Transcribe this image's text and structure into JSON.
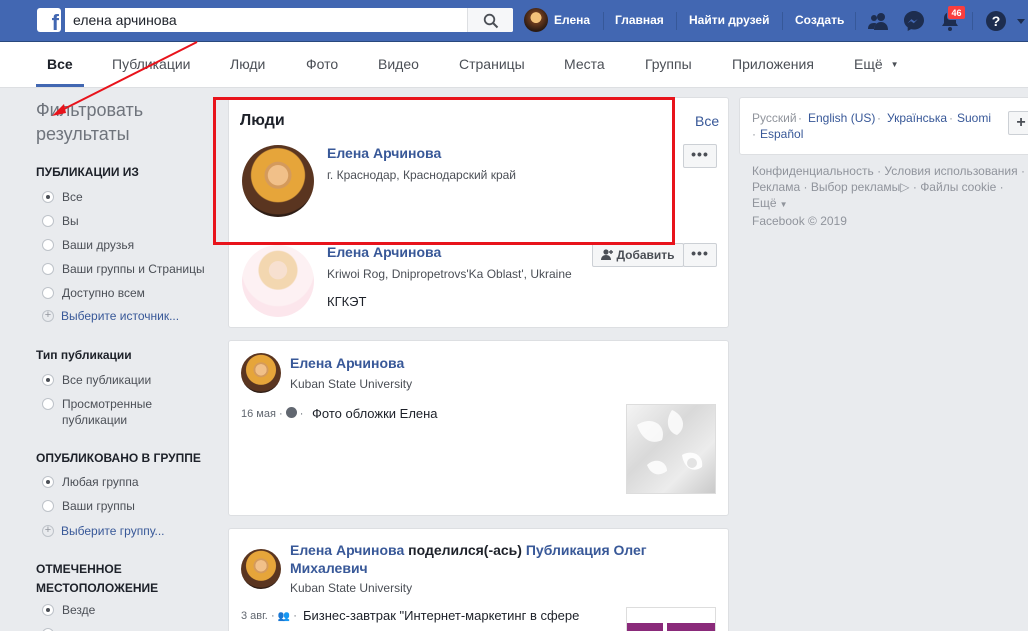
{
  "topbar": {
    "search_value": "елена арчинова",
    "user_name": "Елена",
    "nav_home": "Главная",
    "nav_find_friends": "Найти друзей",
    "nav_create": "Создать",
    "notifications_count": "46"
  },
  "tabs": [
    "Все",
    "Публикации",
    "Люди",
    "Фото",
    "Видео",
    "Страницы",
    "Места",
    "Группы",
    "Приложения",
    "Ещё"
  ],
  "filters": {
    "title": "Фильтровать результаты",
    "posts_from": {
      "heading": "ПУБЛИКАЦИИ ИЗ",
      "options": [
        "Все",
        "Вы",
        "Ваши друзья",
        "Ваши группы и Страницы",
        "Доступно всем"
      ],
      "selected": 0,
      "choose_link": "Выберите источник..."
    },
    "post_type": {
      "heading": "Тип публикации",
      "options": [
        "Все публикации",
        "Просмотренные публикации"
      ],
      "selected": 0
    },
    "posted_in_group": {
      "heading": "ОПУБЛИКОВАНО В ГРУППЕ",
      "options": [
        "Любая группа",
        "Ваши группы"
      ],
      "selected": 0,
      "choose_link": "Выберите группу..."
    },
    "tagged_location": {
      "heading": "ОТМЕЧЕННОЕ МЕСТОПОЛОЖЕНИЕ",
      "options": [
        "Везде"
      ],
      "selected": 0
    }
  },
  "people_card": {
    "heading": "Люди",
    "see_all": "Все",
    "people": [
      {
        "name": "Елена Арчинова",
        "location": "г. Краснодар, Краснодарский край"
      },
      {
        "name": "Елена Арчинова",
        "location": "Kriwoi Rog, Dnipropetrovs'Ka Oblast', Ukraine",
        "extra": "КГКЭТ",
        "add_label": "Добавить"
      }
    ]
  },
  "post1": {
    "author": "Елена Арчинова",
    "subtitle": "Kuban State University",
    "date": "16 мая",
    "text": "Фото обложки Елена"
  },
  "post2": {
    "author": "Елена Арчинова",
    "shared": "поделился(-ась)",
    "target": "Публикация Олег Михалевич",
    "subtitle": "Kuban State University",
    "date": "3 авг.",
    "text": "Бизнес-завтрак \"Интернет-маркетинг в сфере"
  },
  "languages": {
    "items": [
      "Русский",
      "English (US)",
      "Українська",
      "Suomi",
      "Español"
    ],
    "current": "Русский"
  },
  "footer": {
    "links": [
      "Конфиденциальность",
      "Условия использования",
      "Реклама",
      "Выбор рекламы",
      "Файлы cookie",
      "Ещё"
    ],
    "copyright": "Facebook © 2019"
  },
  "colors": {
    "brand": "#4267b2",
    "link": "#385898",
    "annotation": "#e8131b",
    "badge": "#fa3e3e"
  }
}
